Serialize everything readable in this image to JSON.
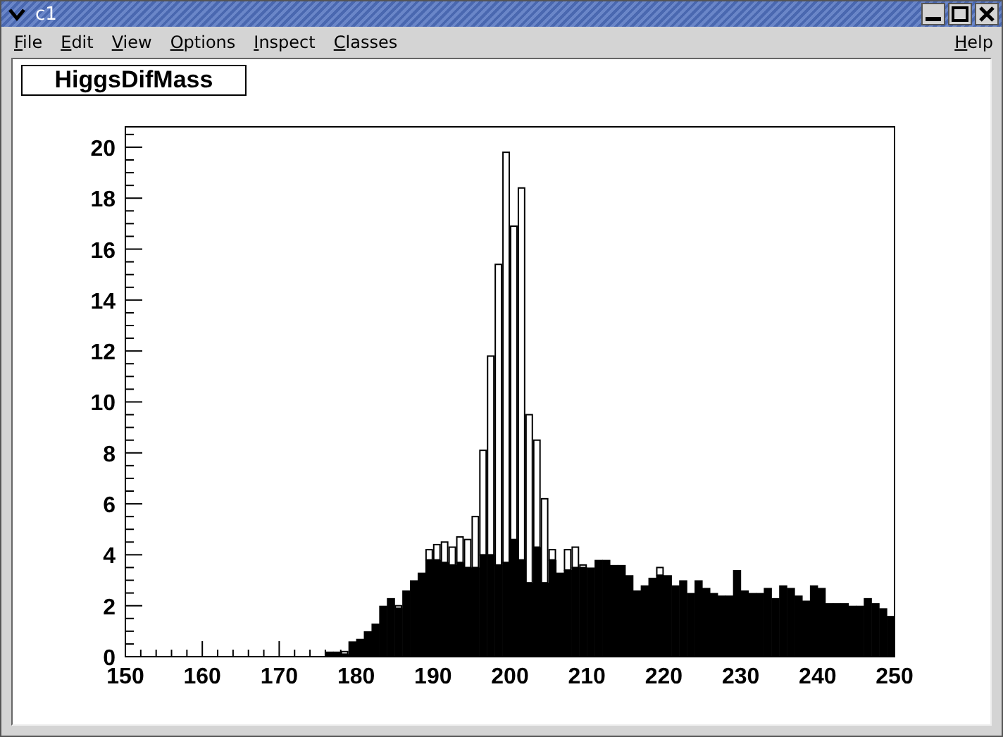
{
  "window": {
    "title": "c1"
  },
  "menu": {
    "items": [
      "File",
      "Edit",
      "View",
      "Options",
      "Inspect",
      "Classes"
    ],
    "help": "Help"
  },
  "canvas": {
    "title": "HiggsDifMass",
    "chart_data": {
      "type": "bar",
      "xlim": [
        150,
        250
      ],
      "ylim": [
        0,
        20.8
      ],
      "xticks": [
        150,
        160,
        170,
        180,
        190,
        200,
        210,
        220,
        230,
        240,
        250
      ],
      "yticks": [
        0,
        2,
        4,
        6,
        8,
        10,
        12,
        14,
        16,
        18,
        20
      ],
      "x": [
        150.5,
        151.5,
        152.5,
        153.5,
        154.5,
        155.5,
        156.5,
        157.5,
        158.5,
        159.5,
        160.5,
        161.5,
        162.5,
        163.5,
        164.5,
        165.5,
        166.5,
        167.5,
        168.5,
        169.5,
        170.5,
        171.5,
        172.5,
        173.5,
        174.5,
        175.5,
        176.5,
        177.5,
        178.5,
        179.5,
        180.5,
        181.5,
        182.5,
        183.5,
        184.5,
        185.5,
        186.5,
        187.5,
        188.5,
        189.5,
        190.5,
        191.5,
        192.5,
        193.5,
        194.5,
        195.5,
        196.5,
        197.5,
        198.5,
        199.5,
        200.5,
        201.5,
        202.5,
        203.5,
        204.5,
        205.5,
        206.5,
        207.5,
        208.5,
        209.5,
        210.5,
        211.5,
        212.5,
        213.5,
        214.5,
        215.5,
        216.5,
        217.5,
        218.5,
        219.5,
        220.5,
        221.5,
        222.5,
        223.5,
        224.5,
        225.5,
        226.5,
        227.5,
        228.5,
        229.5,
        230.5,
        231.5,
        232.5,
        233.5,
        234.5,
        235.5,
        236.5,
        237.5,
        238.5,
        239.5,
        240.5,
        241.5,
        242.5,
        243.5,
        244.5,
        245.5,
        246.5,
        247.5,
        248.5,
        249.5
      ],
      "stacked": true,
      "series": [
        {
          "color": "#000000",
          "values": [
            0,
            0,
            0,
            0,
            0,
            0,
            0,
            0,
            0,
            0,
            0,
            0,
            0,
            0,
            0,
            0,
            0,
            0,
            0,
            0,
            0,
            0,
            0,
            0,
            0,
            0,
            0.2,
            0.2,
            0.1,
            0.6,
            0.7,
            1.0,
            1.3,
            2.0,
            2.3,
            1.9,
            2.6,
            3.0,
            3.3,
            3.8,
            3.8,
            3.7,
            3.6,
            3.7,
            3.5,
            3.5,
            4.0,
            4.0,
            3.6,
            3.7,
            4.6,
            3.8,
            2.9,
            4.3,
            2.9,
            3.8,
            3.3,
            3.4,
            3.5,
            3.5,
            3.5,
            3.8,
            3.8,
            3.6,
            3.6,
            3.2,
            2.6,
            2.8,
            3.1,
            3.2,
            3.2,
            2.8,
            3.0,
            2.5,
            3.0,
            2.7,
            2.5,
            2.4,
            2.4,
            3.4,
            2.6,
            2.5,
            2.5,
            2.7,
            2.3,
            2.8,
            2.7,
            2.4,
            2.2,
            2.8,
            2.7,
            2.1,
            2.1,
            2.1,
            2.0,
            2.0,
            2.3,
            2.1,
            1.9,
            1.6
          ]
        },
        {
          "color": "#ffffff",
          "values": [
            0,
            0,
            0,
            0,
            0,
            0,
            0,
            0,
            0,
            0,
            0,
            0,
            0,
            0,
            0,
            0,
            0,
            0,
            0,
            0,
            0,
            0,
            0,
            0,
            0,
            0,
            0,
            0,
            0.1,
            0,
            0,
            0,
            0,
            0,
            0,
            0.1,
            0,
            0,
            0,
            0.4,
            0.6,
            0.8,
            0.7,
            1.0,
            1.1,
            2.0,
            4.1,
            7.8,
            11.8,
            16.1,
            12.3,
            14.6,
            6.6,
            4.2,
            3.3,
            0.4,
            0,
            0.8,
            0.8,
            0.1,
            0,
            0,
            0,
            0,
            0,
            0,
            0,
            0,
            0,
            0.3,
            0,
            0,
            0,
            0,
            0,
            0,
            0,
            0,
            0,
            0,
            0,
            0,
            0,
            0,
            0,
            0,
            0,
            0,
            0,
            0,
            0,
            0,
            0,
            0,
            0,
            0,
            0,
            0,
            0,
            0
          ]
        }
      ]
    }
  }
}
